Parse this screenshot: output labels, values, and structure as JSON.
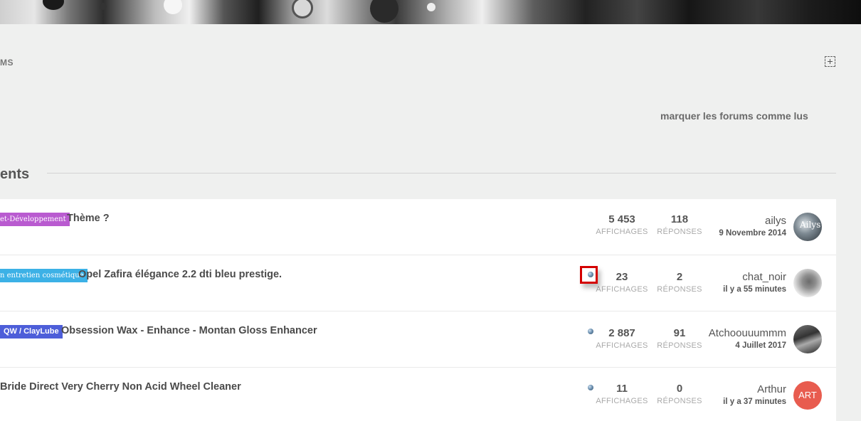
{
  "breadcrumb_tail": "MS",
  "mark_read_label": "marquer les forums comme lus",
  "section_title": "ents",
  "topics": [
    {
      "tag": "et-Développement",
      "tag_color": "#b95bd0",
      "title": "Thème ?",
      "views": "5 453",
      "views_label": "AFFICHAGES",
      "replies": "118",
      "replies_label": "RÉPONSES",
      "last_author": "ailys",
      "last_date": "9 Novembre 2014",
      "avatar_text": "Ailys",
      "unread": false
    },
    {
      "tag": "n entretien cosmétique",
      "tag_color": "#3cb1e6",
      "title": "Opel Zafira élégance 2.2 dti bleu prestige.",
      "views": "23",
      "views_label": "AFFICHAGES",
      "replies": "2",
      "replies_label": "RÉPONSES",
      "last_author": "chat_noir",
      "last_date": "il y a 55 minutes",
      "unread": true
    },
    {
      "tag": "QW / ClayLube",
      "tag_color": "#4d5ed9",
      "title": "Obsession Wax - Enhance - Montan Gloss Enhancer",
      "views": "2 887",
      "views_label": "AFFICHAGES",
      "replies": "91",
      "replies_label": "RÉPONSES",
      "last_author": "Atchoouuummm",
      "last_date": "4 Juillet 2017",
      "unread": true
    },
    {
      "title": "Bride Direct Very Cherry Non Acid Wheel Cleaner",
      "views": "11",
      "views_label": "AFFICHAGES",
      "replies": "0",
      "replies_label": "RÉPONSES",
      "last_author": "Arthur",
      "last_date": "il y a 37 minutes",
      "avatar_text": "ART",
      "avatar_color": "#e85c4f",
      "unread": true
    }
  ]
}
